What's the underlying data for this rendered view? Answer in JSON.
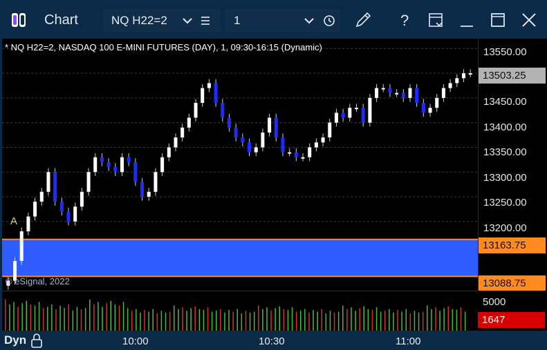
{
  "window": {
    "title": "Chart"
  },
  "toolbar": {
    "symbol": "NQ H22=2",
    "interval": "1"
  },
  "chart": {
    "header": "* NQ H22=2, NASDAQ 100 E-MINI FUTURES (DAY), 1, 09:30-16:15 (Dynamic)",
    "copyright": "© eSignal, 2022",
    "marker": "A",
    "price_axis": [
      "13550.00",
      "13450.00",
      "13400.00",
      "13350.00",
      "13300.00",
      "13250.00",
      "13200.00"
    ],
    "last_price": "13503.25",
    "zone_top_price": "13163.75",
    "zone_bottom_price": "13088.75",
    "volume_axis": "5000",
    "last_volume": "1647",
    "time_axis": [
      "10:00",
      "10:30",
      "11:00"
    ],
    "mode_label": "Dyn"
  },
  "colors": {
    "up_candle": "#ffffff",
    "down_candle": "#1c2cff",
    "zone_fill": "#2e5cff",
    "zone_border": "#ff8a1f",
    "last_price_tag": "#b3b3b3",
    "zone_tag": "#ff8a1f",
    "last_volume_tag": "#d90000",
    "volume_up": "#3fbf3f",
    "volume_down": "#d83030"
  },
  "chart_data": {
    "type": "candlestick",
    "bars_approx": [
      13080,
      13120,
      13180,
      13210,
      13240,
      13260,
      13300,
      13240,
      13220,
      13200,
      13230,
      13260,
      13300,
      13330,
      13320,
      13310,
      13300,
      13330,
      13320,
      13280,
      13250,
      13260,
      13300,
      13330,
      13350,
      13370,
      13390,
      13410,
      13440,
      13470,
      13480,
      13440,
      13410,
      13390,
      13370,
      13360,
      13340,
      13350,
      13380,
      13410,
      13370,
      13340,
      13340,
      13330,
      13330,
      13350,
      13360,
      13370,
      13400,
      13420,
      13410,
      13430,
      13430,
      13400,
      13450,
      13470,
      13470,
      13460,
      13460,
      13450,
      13470,
      13440,
      13420,
      13430,
      13450,
      13470,
      13480,
      13490,
      13500,
      13500
    ],
    "ylim": [
      13060,
      13570
    ]
  }
}
